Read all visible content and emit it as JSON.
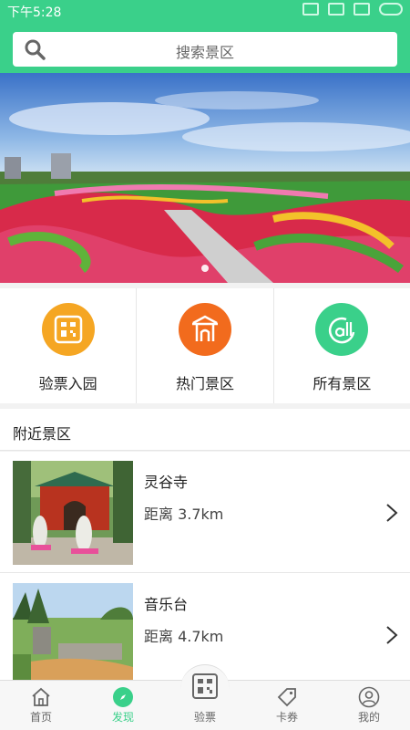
{
  "status": {
    "time": "下午5:28"
  },
  "search": {
    "placeholder": "搜索景区"
  },
  "quick": [
    {
      "label": "验票入园",
      "color": "#f5a623",
      "icon": "ticket-qr-icon"
    },
    {
      "label": "热门景区",
      "color": "#f26b1d",
      "icon": "gate-icon"
    },
    {
      "label": "所有景区",
      "color": "#3ad08a",
      "icon": "all-icon"
    }
  ],
  "nearby": {
    "title": "附近景区",
    "items": [
      {
        "name": "灵谷寺",
        "distance": "距离 3.7km"
      },
      {
        "name": "音乐台",
        "distance": "距离 4.7km"
      }
    ]
  },
  "tabs": [
    {
      "label": "首页",
      "icon": "home-icon"
    },
    {
      "label": "发现",
      "icon": "compass-icon",
      "active": true
    },
    {
      "label": "验票",
      "icon": "ticket-scan-icon"
    },
    {
      "label": "卡券",
      "icon": "coupon-icon"
    },
    {
      "label": "我的",
      "icon": "user-icon"
    }
  ],
  "colors": {
    "brand": "#3ad08a"
  }
}
